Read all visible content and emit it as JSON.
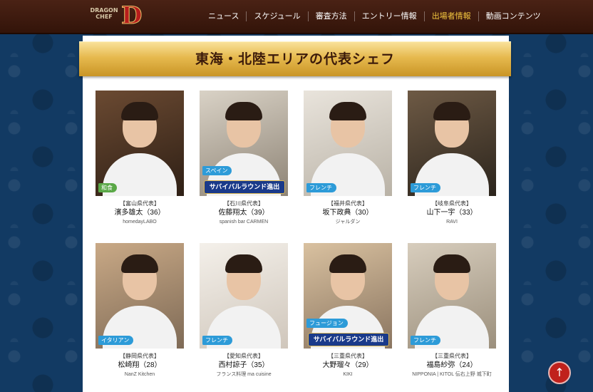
{
  "header": {
    "logo_text": "DRAGON CHEF",
    "logo_letter": "D",
    "nav": [
      "ニュース",
      "スケジュール",
      "審査方法",
      "エントリー情報",
      "出場者情報",
      "動画コンテンツ"
    ],
    "active_nav": "出場者情報"
  },
  "section": {
    "title": "東海・北陸エリアの代表シェフ"
  },
  "chefs": [
    {
      "prefecture": "【富山県代表】",
      "name": "濱多雄太（36）",
      "shop": "homedayLABO",
      "genre": "和食",
      "genre_color": "green",
      "survival": ""
    },
    {
      "prefecture": "【石川県代表】",
      "name": "佐藤翔太（39）",
      "shop": "spanish bar CARMEN",
      "genre": "スペイン",
      "genre_color": "blue",
      "survival": "サバイバルラウンド進出"
    },
    {
      "prefecture": "【福井県代表】",
      "name": "坂下政典（30）",
      "shop": "ジャルダン",
      "genre": "フレンチ",
      "genre_color": "blue",
      "survival": ""
    },
    {
      "prefecture": "【岐阜県代表】",
      "name": "山下一宇（33）",
      "shop": "RAVI",
      "genre": "フレンチ",
      "genre_color": "blue",
      "survival": ""
    },
    {
      "prefecture": "【静岡県代表】",
      "name": "松崎翔（28）",
      "shop": "NanZ Kitchen",
      "genre": "イタリアン",
      "genre_color": "blue",
      "survival": ""
    },
    {
      "prefecture": "【愛知県代表】",
      "name": "西村諒子（35）",
      "shop": "フランス料理 ma cuisine",
      "genre": "フレンチ",
      "genre_color": "blue",
      "survival": ""
    },
    {
      "prefecture": "【三重県代表】",
      "name": "大野瑠々（29）",
      "shop": "KIKI",
      "genre": "フュージョン",
      "genre_color": "blue",
      "survival": "サバイバルラウンド進出"
    },
    {
      "prefecture": "【三重県代表】",
      "name": "福島紗弥（24）",
      "shop": "NIPPONIA | KITOL 伝右上野 城下町",
      "genre": "フレンチ",
      "genre_color": "blue",
      "survival": ""
    }
  ],
  "scroll_top_icon": "↑",
  "colors": {
    "accent_gold": "#e6b94e",
    "header_brown": "#4a2215",
    "page_blue": "#123a63",
    "genre_green": "#5aa847",
    "genre_blue": "#2d9bd8"
  }
}
